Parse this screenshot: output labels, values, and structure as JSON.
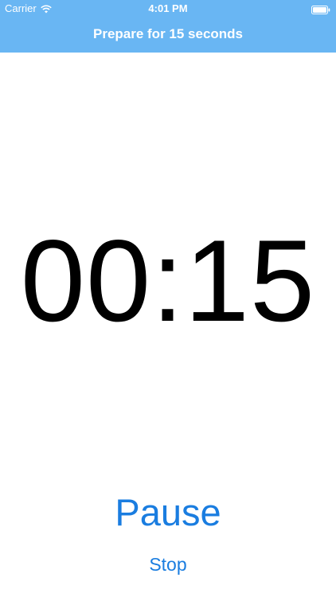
{
  "status_bar": {
    "carrier": "Carrier",
    "time": "4:01 PM",
    "wifi_icon": "wifi-icon",
    "battery_icon": "battery-icon",
    "battery_level": 1.0
  },
  "nav": {
    "title": "Prepare for 15 seconds",
    "background_color": "#69b6f3"
  },
  "timer": {
    "display": "00:15"
  },
  "controls": {
    "pause_label": "Pause",
    "stop_label": "Stop",
    "accent_color": "#1a7de0"
  }
}
